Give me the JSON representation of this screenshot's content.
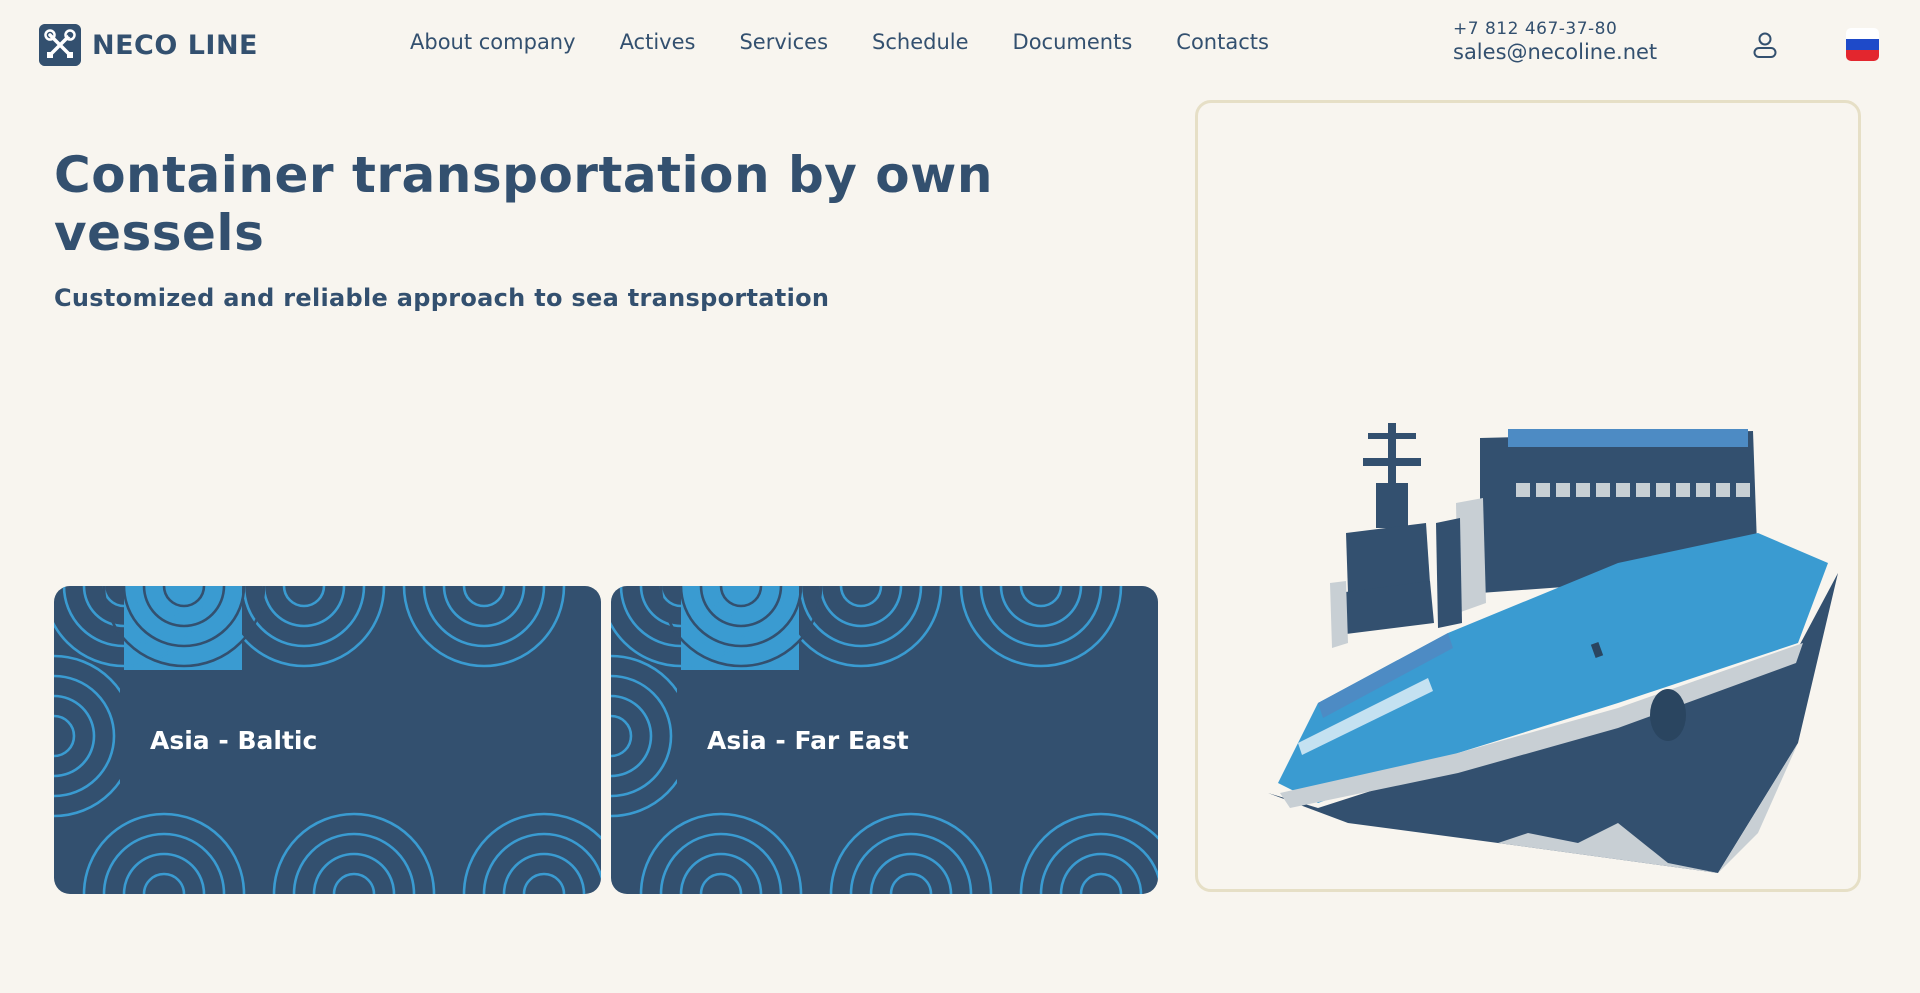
{
  "header": {
    "brand": "NECO LINE",
    "nav": [
      {
        "label": "About company"
      },
      {
        "label": "Actives"
      },
      {
        "label": "Services"
      },
      {
        "label": "Schedule"
      },
      {
        "label": "Documents"
      },
      {
        "label": "Contacts"
      }
    ],
    "phone": "+7 812 467-37-80",
    "email": "sales@necoline.net",
    "user_icon": "user-icon",
    "language_flag": "russia-flag-icon"
  },
  "hero": {
    "title": "Container transportation by own vessels",
    "subtitle": "Customized and reliable approach to sea transportation"
  },
  "routes": [
    {
      "label": "Asia - Baltic"
    },
    {
      "label": "Asia - Far East"
    }
  ],
  "colors": {
    "background": "#f8f5ef",
    "primary": "#33506f",
    "accent": "#3a9bd1",
    "panel_border": "#e6dfc6"
  }
}
